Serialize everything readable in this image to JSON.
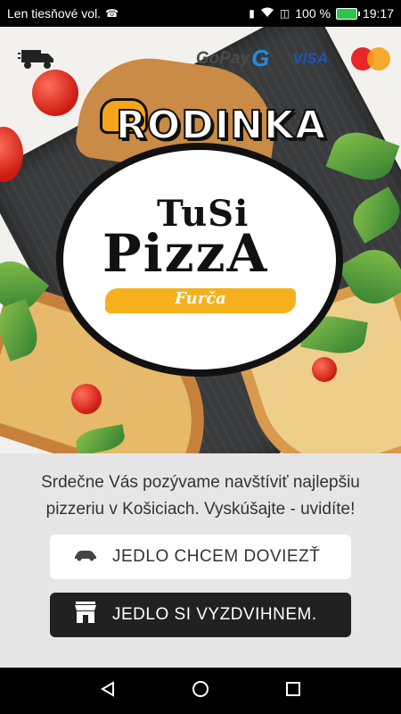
{
  "status_bar": {
    "carrier": "Len tiesňové vol.",
    "battery": "100 %",
    "time": "19:17"
  },
  "header": {
    "icons": [
      "delivery-truck-icon",
      "gopay-logo",
      "visa-logo",
      "mastercard-logo"
    ],
    "gopay_label": "GoPay",
    "gopay_mark": "G",
    "visa_label": "VISA"
  },
  "logo": {
    "brand_top": "RODINKA",
    "brand_small": "TuSi",
    "brand_main": "PizzA",
    "brand_tag": "Furča"
  },
  "main": {
    "invite_text": "Srdečne Vás pozývame navštíviť najlepšiu pizzeriu v Košiciach. Vyskúšajte - uvidíte!",
    "delivery_button": "JEDLO CHCEM DOVIEZŤ",
    "pickup_button": "JEDLO SI VYZDVIHNEM."
  },
  "colors": {
    "accent_yellow": "#f5b11d",
    "dark_button": "#212121",
    "panel_bg": "#e6e6e6"
  }
}
